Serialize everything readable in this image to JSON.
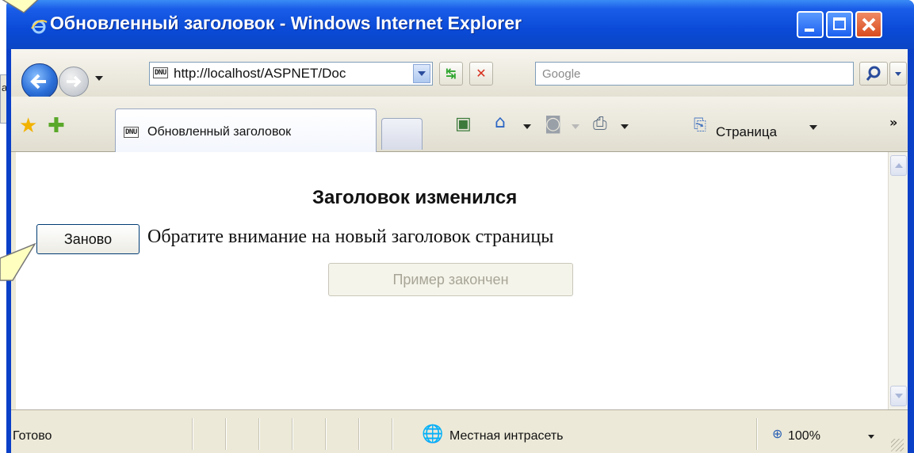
{
  "window": {
    "title": "Обновленный заголовок - Windows Internet Explorer"
  },
  "background": {
    "behind_label": "a"
  },
  "navigation": {
    "address": {
      "favicon": "DNU",
      "value": "http://localhost/ASPNET/Doc"
    },
    "search": {
      "placeholder": "Google"
    }
  },
  "tab": {
    "favicon": "DNU",
    "label": "Обновленный заголовок"
  },
  "toolbar": {
    "page_menu": "Страница",
    "more": "»"
  },
  "page": {
    "heading": "Заголовок изменился",
    "again_button": "Заново",
    "note": "Обратите внимание на новый заголовок страницы",
    "done_button": "Пример закончен"
  },
  "status": {
    "text": "Готово",
    "zone": "Местная интрасеть",
    "zoom": "100%"
  }
}
